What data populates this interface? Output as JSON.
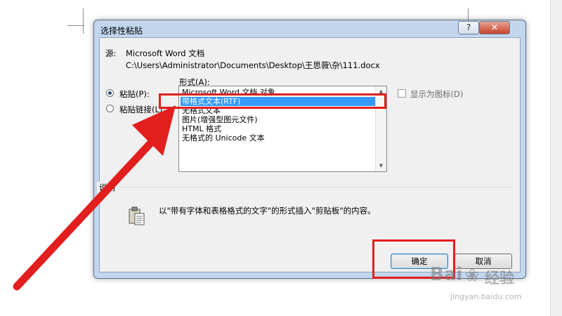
{
  "dialog": {
    "title": "选择性粘贴",
    "help_label": "?",
    "close_label": "✕",
    "source_label": "源:",
    "source_app": "Microsoft Word 文档",
    "source_path": "C:\\Users\\Administrator\\Documents\\Desktop\\王思薇\\杂\\111.docx",
    "format_label": "形式(A):",
    "radio_paste": "粘贴(P):",
    "radio_paste_link": "粘贴链接(L):",
    "formats": [
      "Microsoft Word 文档 对象",
      "带格式文本(RTF)",
      "无格式文本",
      "图片(增强型图元文件)",
      "HTML 格式",
      "无格式的 Unicode 文本"
    ],
    "selected_index": 1,
    "display_as_icon": "显示为图标(D)",
    "description_label": "说明",
    "description_text": "以\"带有字体和表格格式的文字\"的形式插入\"剪贴板\"的内容。",
    "ok_label": "确定",
    "cancel_label": "取消"
  },
  "watermark": {
    "brand": "Bai",
    "brand_suffix": "经验",
    "url": "jingyan.baidu.com"
  },
  "colors": {
    "annotation": "#e21e1e",
    "selection": "#3399ff"
  }
}
